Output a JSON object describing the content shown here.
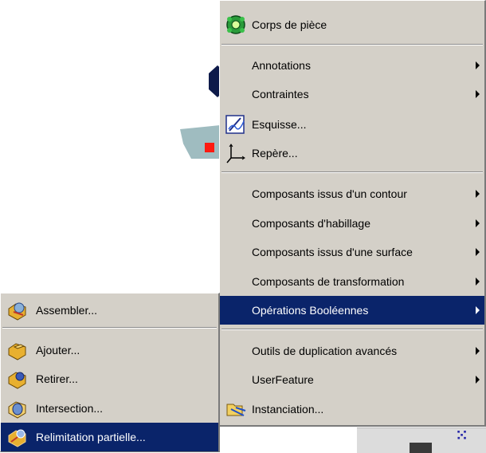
{
  "main_menu": {
    "items": [
      {
        "label": "Corps de pièce",
        "icon": "part-body-icon"
      },
      {
        "label": "Annotations",
        "submenu": true
      },
      {
        "label": "Contraintes",
        "submenu": true
      },
      {
        "label": "Esquisse...",
        "icon": "sketch-icon"
      },
      {
        "label": "Repère...",
        "icon": "axis-system-icon"
      },
      {
        "label": "Composants issus d'un contour",
        "submenu": true
      },
      {
        "label": "Composants d'habillage",
        "submenu": true
      },
      {
        "label": "Composants issus d'une surface",
        "submenu": true
      },
      {
        "label": "Composants de transformation",
        "submenu": true
      },
      {
        "label": "Opérations Booléennes",
        "submenu": true,
        "highlighted": true
      },
      {
        "label": "Outils de duplication avancés",
        "submenu": true
      },
      {
        "label": "UserFeature",
        "submenu": true
      },
      {
        "label": "Instanciation...",
        "icon": "instantiation-icon"
      }
    ]
  },
  "sub_menu": {
    "items": [
      {
        "label": "Assembler...",
        "icon": "assemble-icon"
      },
      {
        "label": "Ajouter...",
        "icon": "add-icon"
      },
      {
        "label": "Retirer...",
        "icon": "remove-icon"
      },
      {
        "label": "Intersection...",
        "icon": "intersect-icon"
      },
      {
        "label": "Relimitation partielle...",
        "icon": "union-trim-icon",
        "highlighted": true
      }
    ]
  },
  "colors": {
    "menu_bg": "#d4d0c8",
    "highlight": "#0a246a",
    "highlight_text": "#ffffff"
  }
}
